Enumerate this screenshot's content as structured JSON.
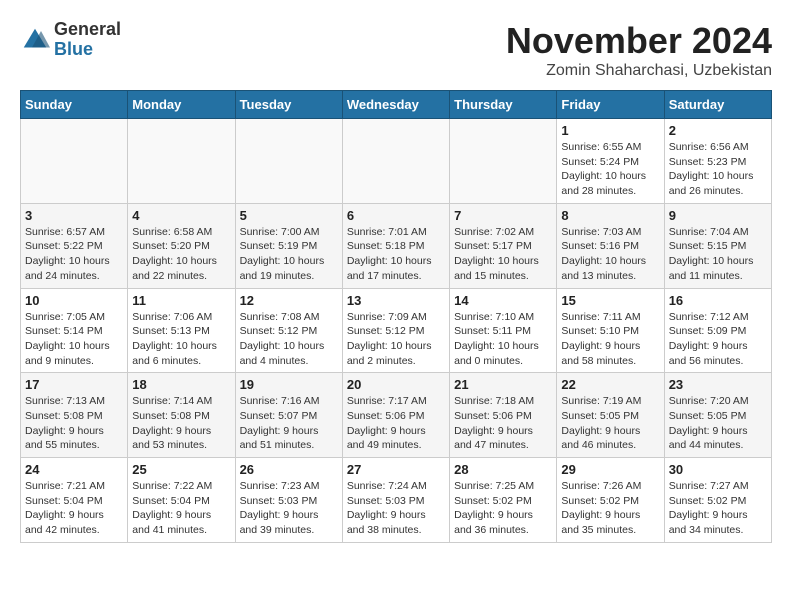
{
  "logo": {
    "general": "General",
    "blue": "Blue"
  },
  "title": "November 2024",
  "subtitle": "Zomin Shaharchasi, Uzbekistan",
  "weekdays": [
    "Sunday",
    "Monday",
    "Tuesday",
    "Wednesday",
    "Thursday",
    "Friday",
    "Saturday"
  ],
  "weeks": [
    [
      {
        "day": "",
        "info": ""
      },
      {
        "day": "",
        "info": ""
      },
      {
        "day": "",
        "info": ""
      },
      {
        "day": "",
        "info": ""
      },
      {
        "day": "",
        "info": ""
      },
      {
        "day": "1",
        "info": "Sunrise: 6:55 AM\nSunset: 5:24 PM\nDaylight: 10 hours and 28 minutes."
      },
      {
        "day": "2",
        "info": "Sunrise: 6:56 AM\nSunset: 5:23 PM\nDaylight: 10 hours and 26 minutes."
      }
    ],
    [
      {
        "day": "3",
        "info": "Sunrise: 6:57 AM\nSunset: 5:22 PM\nDaylight: 10 hours and 24 minutes."
      },
      {
        "day": "4",
        "info": "Sunrise: 6:58 AM\nSunset: 5:20 PM\nDaylight: 10 hours and 22 minutes."
      },
      {
        "day": "5",
        "info": "Sunrise: 7:00 AM\nSunset: 5:19 PM\nDaylight: 10 hours and 19 minutes."
      },
      {
        "day": "6",
        "info": "Sunrise: 7:01 AM\nSunset: 5:18 PM\nDaylight: 10 hours and 17 minutes."
      },
      {
        "day": "7",
        "info": "Sunrise: 7:02 AM\nSunset: 5:17 PM\nDaylight: 10 hours and 15 minutes."
      },
      {
        "day": "8",
        "info": "Sunrise: 7:03 AM\nSunset: 5:16 PM\nDaylight: 10 hours and 13 minutes."
      },
      {
        "day": "9",
        "info": "Sunrise: 7:04 AM\nSunset: 5:15 PM\nDaylight: 10 hours and 11 minutes."
      }
    ],
    [
      {
        "day": "10",
        "info": "Sunrise: 7:05 AM\nSunset: 5:14 PM\nDaylight: 10 hours and 9 minutes."
      },
      {
        "day": "11",
        "info": "Sunrise: 7:06 AM\nSunset: 5:13 PM\nDaylight: 10 hours and 6 minutes."
      },
      {
        "day": "12",
        "info": "Sunrise: 7:08 AM\nSunset: 5:12 PM\nDaylight: 10 hours and 4 minutes."
      },
      {
        "day": "13",
        "info": "Sunrise: 7:09 AM\nSunset: 5:12 PM\nDaylight: 10 hours and 2 minutes."
      },
      {
        "day": "14",
        "info": "Sunrise: 7:10 AM\nSunset: 5:11 PM\nDaylight: 10 hours and 0 minutes."
      },
      {
        "day": "15",
        "info": "Sunrise: 7:11 AM\nSunset: 5:10 PM\nDaylight: 9 hours and 58 minutes."
      },
      {
        "day": "16",
        "info": "Sunrise: 7:12 AM\nSunset: 5:09 PM\nDaylight: 9 hours and 56 minutes."
      }
    ],
    [
      {
        "day": "17",
        "info": "Sunrise: 7:13 AM\nSunset: 5:08 PM\nDaylight: 9 hours and 55 minutes."
      },
      {
        "day": "18",
        "info": "Sunrise: 7:14 AM\nSunset: 5:08 PM\nDaylight: 9 hours and 53 minutes."
      },
      {
        "day": "19",
        "info": "Sunrise: 7:16 AM\nSunset: 5:07 PM\nDaylight: 9 hours and 51 minutes."
      },
      {
        "day": "20",
        "info": "Sunrise: 7:17 AM\nSunset: 5:06 PM\nDaylight: 9 hours and 49 minutes."
      },
      {
        "day": "21",
        "info": "Sunrise: 7:18 AM\nSunset: 5:06 PM\nDaylight: 9 hours and 47 minutes."
      },
      {
        "day": "22",
        "info": "Sunrise: 7:19 AM\nSunset: 5:05 PM\nDaylight: 9 hours and 46 minutes."
      },
      {
        "day": "23",
        "info": "Sunrise: 7:20 AM\nSunset: 5:05 PM\nDaylight: 9 hours and 44 minutes."
      }
    ],
    [
      {
        "day": "24",
        "info": "Sunrise: 7:21 AM\nSunset: 5:04 PM\nDaylight: 9 hours and 42 minutes."
      },
      {
        "day": "25",
        "info": "Sunrise: 7:22 AM\nSunset: 5:04 PM\nDaylight: 9 hours and 41 minutes."
      },
      {
        "day": "26",
        "info": "Sunrise: 7:23 AM\nSunset: 5:03 PM\nDaylight: 9 hours and 39 minutes."
      },
      {
        "day": "27",
        "info": "Sunrise: 7:24 AM\nSunset: 5:03 PM\nDaylight: 9 hours and 38 minutes."
      },
      {
        "day": "28",
        "info": "Sunrise: 7:25 AM\nSunset: 5:02 PM\nDaylight: 9 hours and 36 minutes."
      },
      {
        "day": "29",
        "info": "Sunrise: 7:26 AM\nSunset: 5:02 PM\nDaylight: 9 hours and 35 minutes."
      },
      {
        "day": "30",
        "info": "Sunrise: 7:27 AM\nSunset: 5:02 PM\nDaylight: 9 hours and 34 minutes."
      }
    ]
  ]
}
